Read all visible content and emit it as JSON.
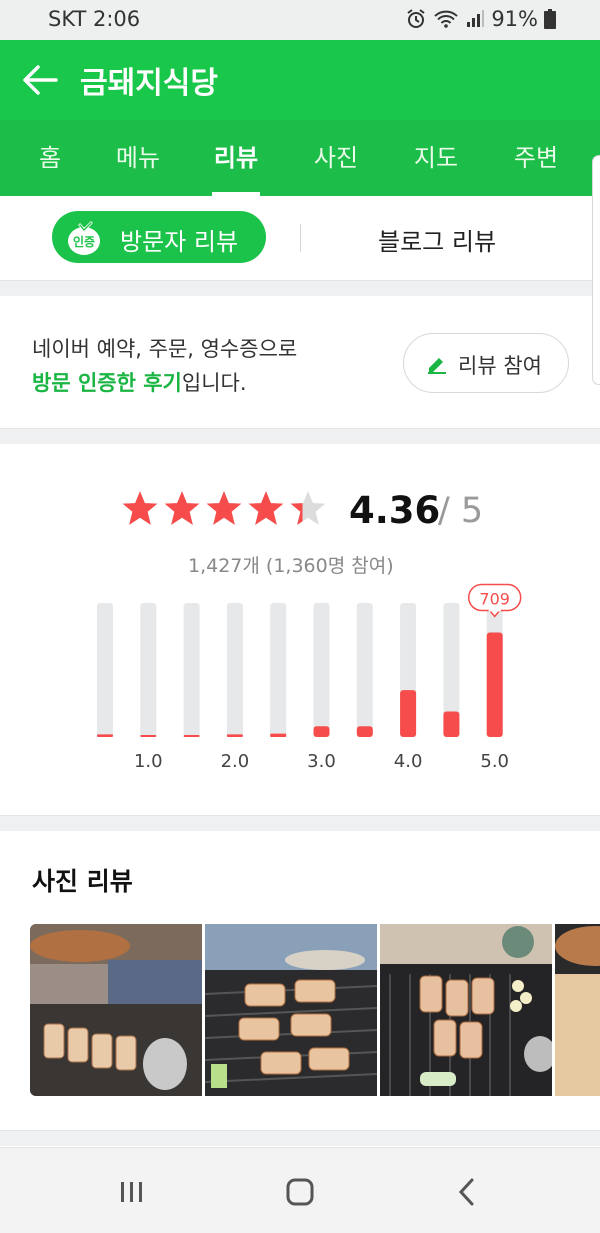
{
  "status_bar": {
    "carrier_time": "SKT 2:06",
    "battery": "91%"
  },
  "header": {
    "title": "금돼지식당"
  },
  "tabs": [
    {
      "label": "홈"
    },
    {
      "label": "메뉴"
    },
    {
      "label": "리뷰"
    },
    {
      "label": "사진"
    },
    {
      "label": "지도"
    },
    {
      "label": "주변"
    }
  ],
  "review_switch": {
    "verified_badge": "인증",
    "visitor_label": "방문자 리뷰",
    "blog_label": "블로그 리뷰"
  },
  "info": {
    "line1": "네이버 예약, 주문, 영수증으로",
    "line2_highlight": "방문 인증한 후기",
    "line2_rest": "입니다.",
    "join_label": "리뷰 참여"
  },
  "rating": {
    "score": "4.36",
    "out_of": "/ 5",
    "count_text": "1,427개 (1,360명 참여)",
    "stars_filled": 4.36
  },
  "chart_data": {
    "type": "bar",
    "categories": [
      "0.5",
      "1.0",
      "1.5",
      "2.0",
      "2.5",
      "3.0",
      "3.5",
      "4.0",
      "4.5",
      "5.0"
    ],
    "values": [
      5,
      2,
      1,
      5,
      6,
      19,
      19,
      80,
      42,
      709
    ],
    "tick_labels": [
      "1.0",
      "2.0",
      "3.0",
      "4.0",
      "5.0"
    ],
    "tick_positions": [
      "1.0",
      "2.0",
      "3.0",
      "4.0",
      "5.0"
    ],
    "data_label": "709",
    "fill_fraction": [
      0.02,
      0.01,
      0.005,
      0.02,
      0.025,
      0.08,
      0.08,
      0.35,
      0.19,
      0.78
    ],
    "colors": {
      "bar": "#f64c4c",
      "track": "#e6e8ea"
    }
  },
  "photo_reviews": {
    "heading": "사진 리뷰",
    "thumbnails": [
      {
        "label": "grilled-pork-photo-1"
      },
      {
        "label": "grilled-pork-photo-2"
      },
      {
        "label": "grilled-pork-photo-3"
      },
      {
        "label": "grilled-pork-photo-4"
      }
    ]
  },
  "colors": {
    "brand_green": "#19c84a",
    "star_red": "#f64c4c"
  }
}
